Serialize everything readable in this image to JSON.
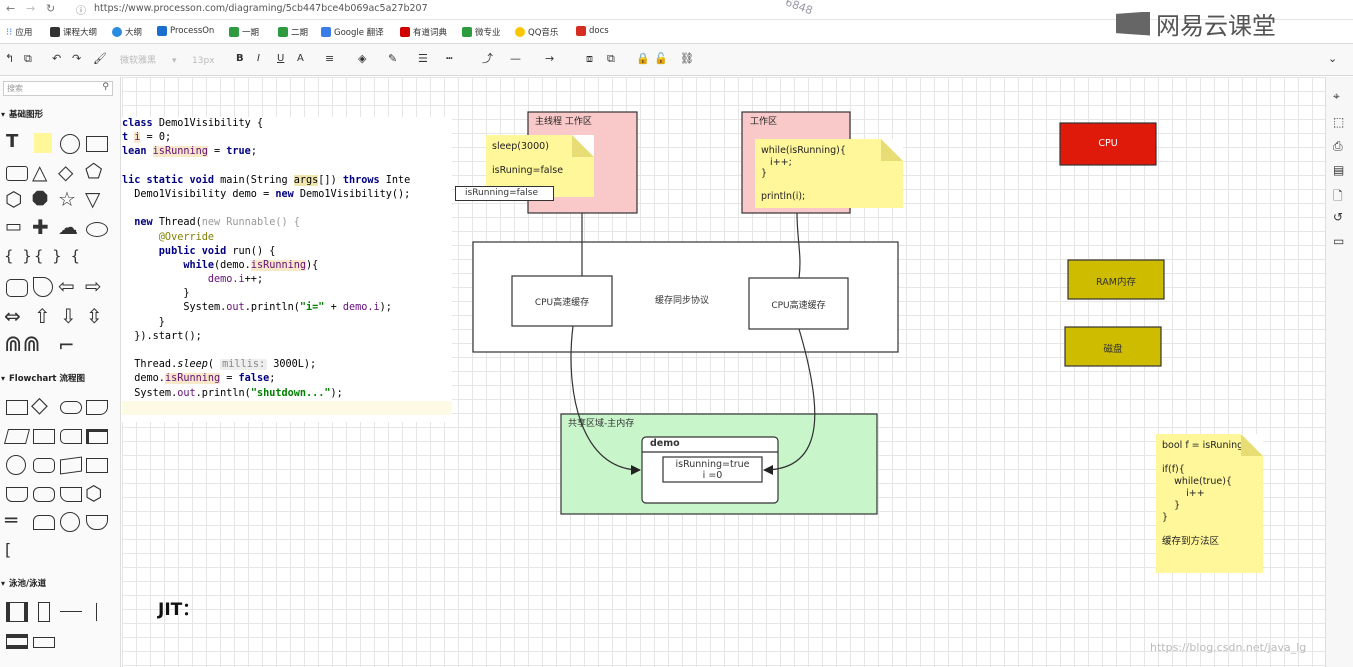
{
  "browser": {
    "url": "https://www.processon.com/diagraming/5cb447bce4b069ac5a27b207",
    "bookmarks": [
      "应用",
      "课程大纲",
      "大纲",
      "ProcessOn",
      "一期",
      "二期",
      "Google 翻译",
      "有道词典",
      "微专业",
      "QQ音乐",
      "docs"
    ]
  },
  "brand": {
    "name": "网易云课堂"
  },
  "toolbar": {
    "font_name": "微软雅黑",
    "font_size": "13px"
  },
  "sidebar": {
    "search_placeholder": "搜索",
    "sections": [
      "基础图形",
      "Flowchart 流程图",
      "泳池/泳道"
    ]
  },
  "code_lines": [
    {
      "parts": [
        [
          "kw",
          "class "
        ],
        [
          "",
          "Demo1Visibility {"
        ]
      ]
    },
    {
      "parts": [
        [
          "kw",
          "t "
        ],
        [
          "fld",
          "i"
        ],
        [
          "",
          " = 0;"
        ]
      ]
    },
    {
      "parts": [
        [
          "kw",
          "lean "
        ],
        [
          "fld",
          "isRunning"
        ],
        [
          "",
          " = "
        ],
        [
          "kw",
          "true"
        ],
        [
          "",
          ";"
        ]
      ]
    },
    {
      "parts": [
        [
          "",
          ""
        ]
      ]
    },
    {
      "parts": [
        [
          "kw",
          "lic static void "
        ],
        [
          "",
          "main(String "
        ],
        [
          "hl2",
          "args"
        ],
        [
          "",
          "[]) "
        ],
        [
          "kw",
          "throws "
        ],
        [
          "",
          "Inte"
        ]
      ]
    },
    {
      "parts": [
        [
          "",
          "  Demo1Visibility demo = "
        ],
        [
          "kw",
          "new "
        ],
        [
          "",
          "Demo1Visibility();"
        ]
      ]
    },
    {
      "parts": [
        [
          "",
          ""
        ]
      ]
    },
    {
      "parts": [
        [
          "kw",
          "  new "
        ],
        [
          "",
          "Thread("
        ],
        [
          "grey",
          "new Runnable() {"
        ]
      ]
    },
    {
      "parts": [
        [
          "ann",
          "      @Override"
        ]
      ]
    },
    {
      "parts": [
        [
          "kw",
          "      public void "
        ],
        [
          "",
          "run() {"
        ]
      ]
    },
    {
      "parts": [
        [
          "kw",
          "          while"
        ],
        [
          "",
          "(demo."
        ],
        [
          "fld",
          "isRunning"
        ],
        [
          "",
          ""
        ],
        [
          "",
          ")"
        ],
        [
          "",
          "{"
        ]
      ]
    },
    {
      "parts": [
        [
          "fld",
          "              demo.i"
        ],
        [
          "",
          "++;"
        ]
      ]
    },
    {
      "parts": [
        [
          "",
          "          }"
        ]
      ]
    },
    {
      "parts": [
        [
          "",
          "          System."
        ],
        [
          "fld",
          "out"
        ],
        [
          "",
          ".println("
        ],
        [
          "st",
          "\"i=\""
        ],
        [
          "",
          " + "
        ],
        [
          "fld",
          "demo.i"
        ],
        [
          "",
          ");"
        ]
      ]
    },
    {
      "parts": [
        [
          "",
          "      }"
        ]
      ]
    },
    {
      "parts": [
        [
          "",
          "  }).start();"
        ]
      ]
    },
    {
      "parts": [
        [
          "",
          ""
        ]
      ]
    },
    {
      "parts": [
        [
          "",
          "  Thread."
        ],
        [
          "it",
          "sleep"
        ],
        [
          "",
          "( "
        ],
        [
          "hint",
          "millis:"
        ],
        [
          "",
          " 3000L);"
        ]
      ]
    },
    {
      "parts": [
        [
          "",
          "  demo."
        ],
        [
          "fld",
          "isRunning"
        ],
        [
          "",
          " = "
        ],
        [
          "kw",
          "false"
        ],
        [
          "",
          ";"
        ]
      ]
    },
    {
      "parts": [
        [
          "",
          "  System."
        ],
        [
          "fld",
          "out"
        ],
        [
          "",
          ".println("
        ],
        [
          "st",
          "\"shutdown...\""
        ],
        [
          "",
          ");"
        ]
      ]
    },
    {
      "parts": [
        [
          "",
          ""
        ]
      ]
    }
  ],
  "diagram": {
    "main_thread_label": "主线程 工作区",
    "worker_label": "工作区",
    "note_main": [
      "sleep(3000)",
      "",
      "isRuning=false"
    ],
    "isrunning_box": "isRunning=false",
    "note_worker": [
      "while(isRunning){",
      "   i++;",
      "}",
      "",
      "println(i);"
    ],
    "cache_sync_label": "缓存同步协议",
    "cpu_cache_left": "CPU高速缓存",
    "cpu_cache_right": "CPU高速缓存",
    "shared_label": "共享区域-主内存",
    "demo_title": "demo",
    "demo_fields": [
      "isRunning=true",
      "i =0"
    ],
    "cpu": "CPU",
    "ram": "RAM内存",
    "disk": "磁盘",
    "note_right": [
      "bool f = isRuning",
      "",
      "if(f){",
      "    while(true){",
      "        i++",
      "    }",
      "}",
      "",
      "缓存到方法区"
    ],
    "colors": {
      "cpu": "#e01a0a",
      "ram": "#cdbc00",
      "pink": "#f9c8c8",
      "green": "#c9f5cb",
      "note": "#fff799"
    }
  },
  "jit_label": "JIT：",
  "watermark": "https://blog.csdn.net/java_lg",
  "watermark2": "6848"
}
